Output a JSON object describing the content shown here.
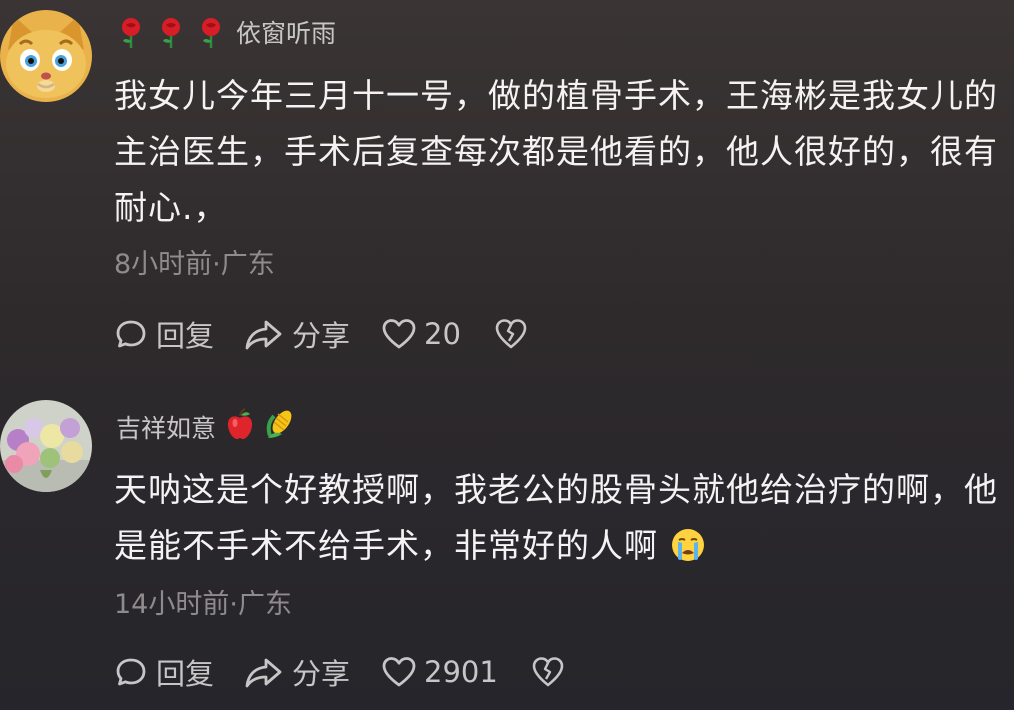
{
  "comments": [
    {
      "username": "依窗听雨",
      "text_lines": [
        "我女儿今年三月十一号，做的植骨手术，王海彬是我女儿的",
        "主治医生，手术后复查每次都是他看的，他人很好的，很有",
        "耐心.，"
      ],
      "meta": "8小时前·广东",
      "reply_label": "回复",
      "share_label": "分享",
      "like_count": "20"
    },
    {
      "username": "吉祥如意",
      "text_lines": [
        "天呐这是个好教授啊，我老公的股骨头就他给治疗的啊，他",
        "是能不手术不给手术，非常好的人啊"
      ],
      "meta": "14小时前·广东",
      "reply_label": "回复",
      "share_label": "分享",
      "like_count": "2901"
    }
  ],
  "icons": {
    "reply": "comment-bubble-icon",
    "share": "share-arrow-icon",
    "like": "heart-icon",
    "dislike": "broken-heart-icon",
    "rose": "rose-emoji",
    "apple": "apple-emoji",
    "corn": "corn-emoji",
    "crying": "crying-face-emoji"
  }
}
